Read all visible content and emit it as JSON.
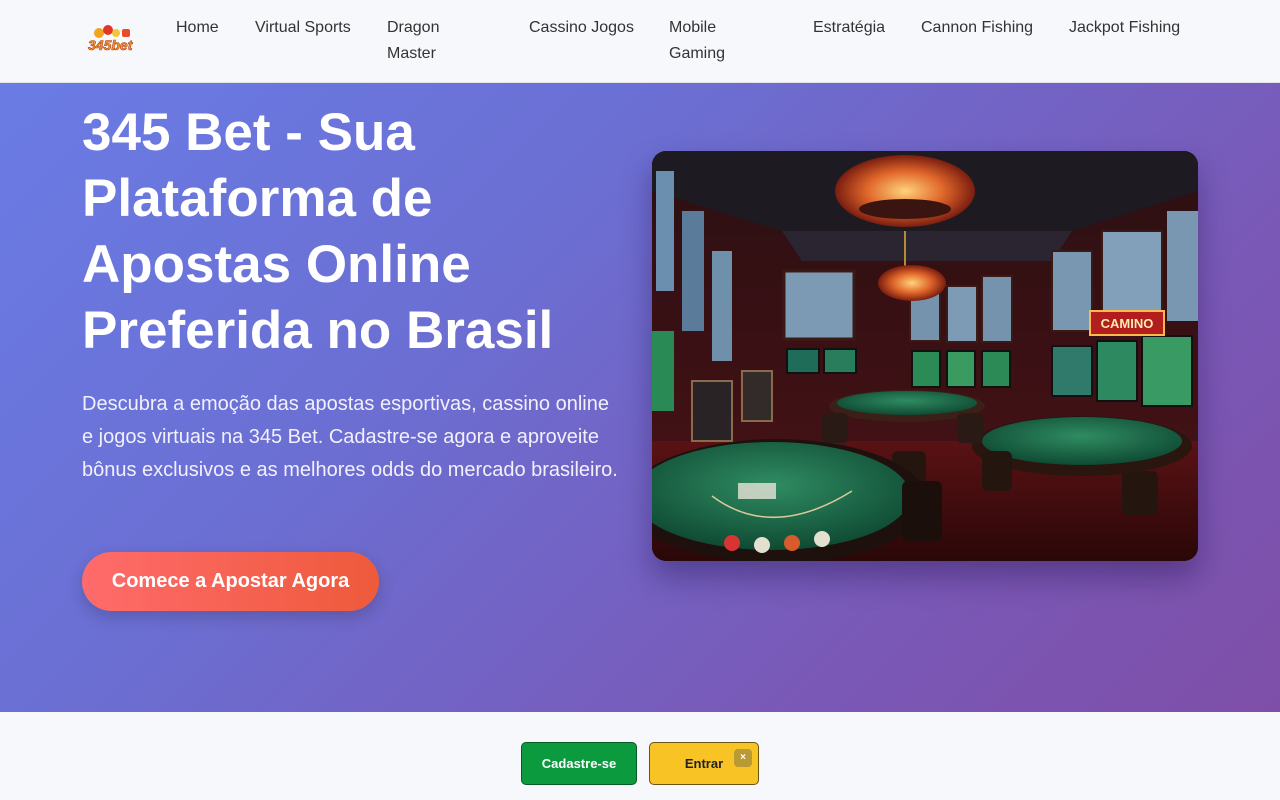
{
  "logo": {
    "text": "345bet"
  },
  "nav": {
    "items": [
      {
        "label": "Home"
      },
      {
        "label": "Virtual Sports"
      },
      {
        "label": "Dragon Master"
      },
      {
        "label": "Cassino Jogos"
      },
      {
        "label": "Mobile Gaming"
      },
      {
        "label": "Estratégia"
      },
      {
        "label": "Cannon Fishing"
      },
      {
        "label": "Jackpot Fishing"
      }
    ]
  },
  "hero": {
    "title": "345 Bet - Sua Plataforma de Apostas Online Preferida no Brasil",
    "description": "Descubra a emoção das apostas esportivas, cassino online e jogos virtuais na 345 Bet. Cadastre-se agora e aproveite bônus exclusivos e as melhores odds do mercado brasileiro.",
    "cta_label": "Comece a Apostar Agora",
    "image_sign": "CAMINO"
  },
  "bottom_bar": {
    "register_label": "Cadastre-se",
    "login_label": "Entrar",
    "close_label": "×"
  }
}
